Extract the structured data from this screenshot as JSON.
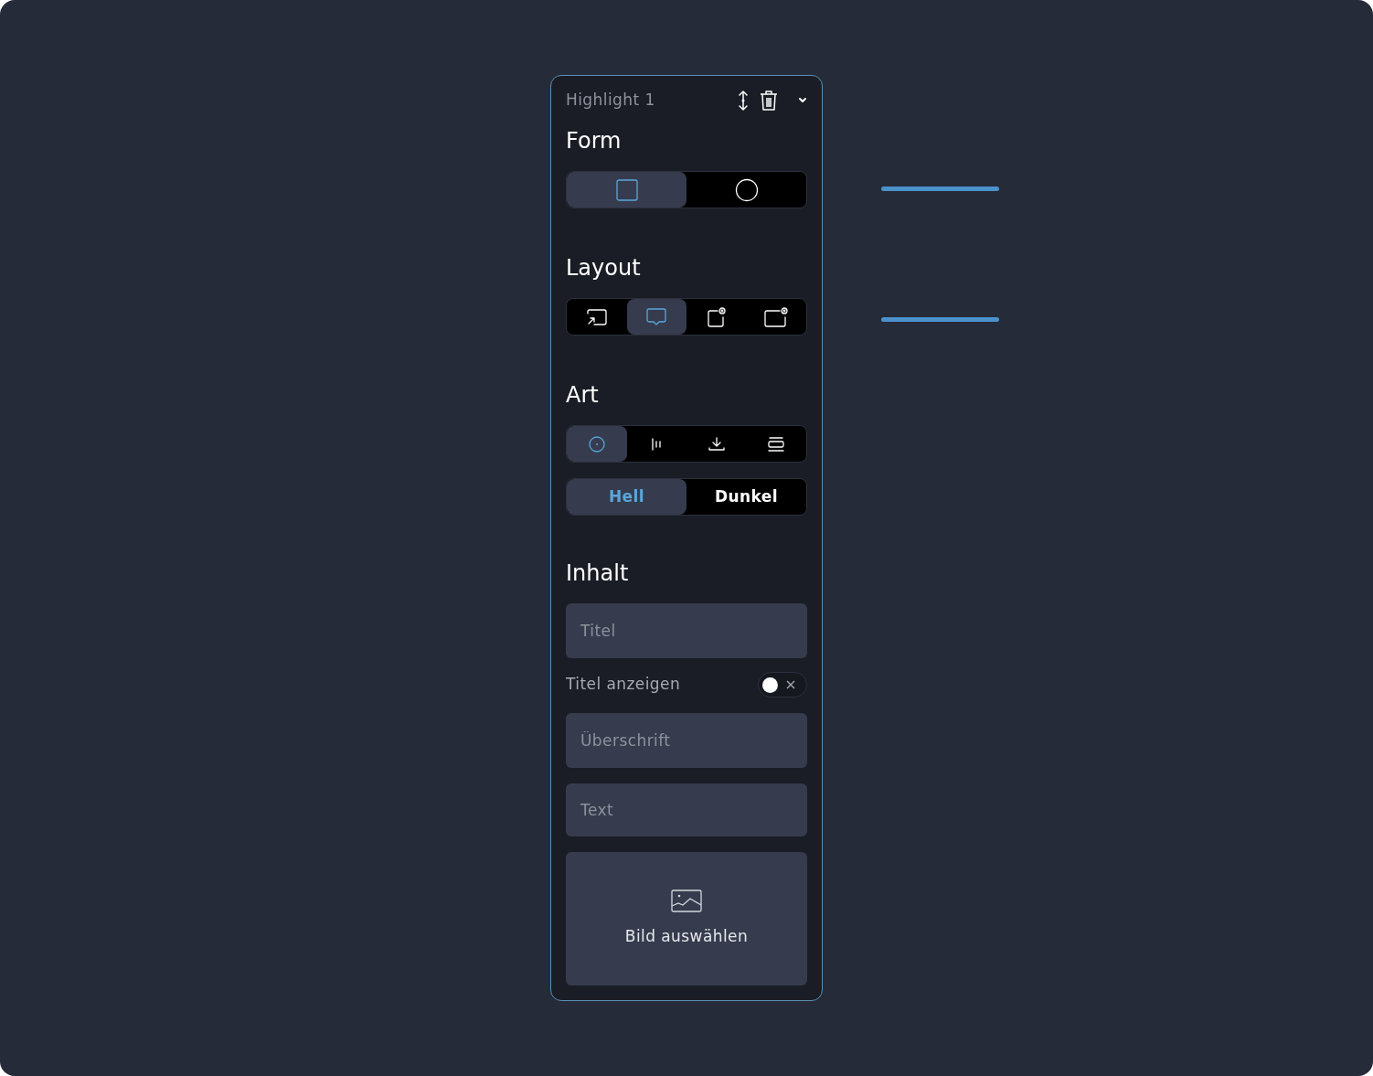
{
  "panel": {
    "title": "Highlight 1"
  },
  "sections": [
    {
      "title": "Form",
      "options": [
        {
          "kind": "square",
          "selected": true
        },
        {
          "kind": "circle",
          "selected": false
        }
      ]
    },
    {
      "title": "Layout",
      "options": [
        {
          "kind": "arrow-frame",
          "selected": false
        },
        {
          "kind": "speech-bubble",
          "selected": true
        },
        {
          "kind": "badge-narrow",
          "selected": false
        },
        {
          "kind": "badge-wide",
          "selected": false
        }
      ]
    },
    {
      "title": "Art",
      "options": [
        {
          "kind": "dot-circle",
          "selected": true
        },
        {
          "kind": "bars",
          "selected": false
        },
        {
          "kind": "download",
          "selected": false
        },
        {
          "kind": "stack",
          "selected": false
        }
      ],
      "themes": [
        {
          "label": "Hell",
          "selected": true
        },
        {
          "label": "Dunkel",
          "selected": false
        }
      ]
    }
  ],
  "content": {
    "title": "Inhalt",
    "title_field": {
      "placeholder": "Titel"
    },
    "show_title": {
      "label": "Titel anzeigen",
      "on": false
    },
    "fields": [
      {
        "placeholder": "Überschrift"
      },
      {
        "placeholder": "Text"
      }
    ],
    "image_picker": {
      "label": "Bild auswählen"
    }
  }
}
